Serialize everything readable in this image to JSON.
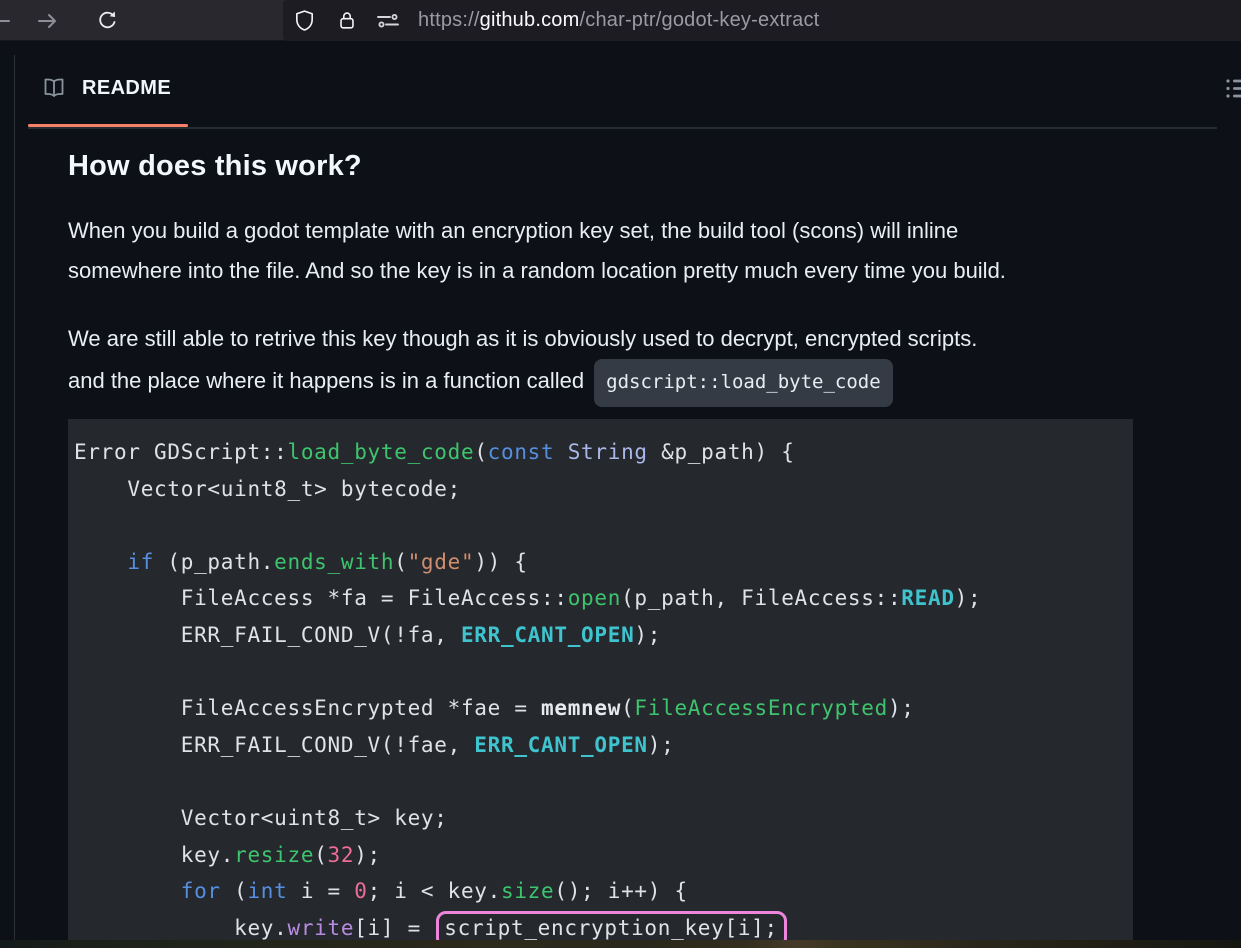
{
  "browser": {
    "url_scheme": "https://",
    "url_domain": "github.com",
    "url_path": "/char-ptr/godot-key-extract"
  },
  "readme": {
    "tab_label": "README",
    "heading": "How does this work?",
    "paragraph1_line1": "When you build a godot template with an encryption key set, the build tool (scons) will inline",
    "paragraph1_line2": "somewhere into the file. And so the key is in a random location pretty much every time you build.",
    "paragraph2_line1": "We are still able to retrive this key though as it is obviously used to decrypt, encrypted scripts.",
    "paragraph2_line2_text": "and the place where it happens is in a function called",
    "paragraph2_inline_code": "gdscript::load_byte_code"
  },
  "code_block": {
    "language": "cpp",
    "annotation": "pink rounded box highlighting script_encryption_key[i];",
    "lines": [
      {
        "tokens": [
          {
            "t": "Error GDScript::",
            "c": "pl"
          },
          {
            "t": "load_byte_code",
            "c": "fn"
          },
          {
            "t": "(",
            "c": "pl"
          },
          {
            "t": "const",
            "c": "kw"
          },
          {
            "t": " ",
            "c": "pl"
          },
          {
            "t": "String",
            "c": "ty"
          },
          {
            "t": " &p_path) {",
            "c": "pl"
          }
        ]
      },
      {
        "tokens": [
          {
            "t": "    Vector<uint8_t> bytecode;",
            "c": "pl"
          }
        ]
      },
      {
        "tokens": []
      },
      {
        "tokens": [
          {
            "t": "    ",
            "c": "pl"
          },
          {
            "t": "if",
            "c": "kw"
          },
          {
            "t": " (p_path.",
            "c": "pl"
          },
          {
            "t": "ends_with",
            "c": "fn"
          },
          {
            "t": "(",
            "c": "pl"
          },
          {
            "t": "\"gde\"",
            "c": "st"
          },
          {
            "t": ")) {",
            "c": "pl"
          }
        ]
      },
      {
        "tokens": [
          {
            "t": "        FileAccess *fa = FileAccess::",
            "c": "pl"
          },
          {
            "t": "open",
            "c": "fn"
          },
          {
            "t": "(p_path, FileAccess::",
            "c": "pl"
          },
          {
            "t": "READ",
            "c": "ct"
          },
          {
            "t": ");",
            "c": "pl"
          }
        ]
      },
      {
        "tokens": [
          {
            "t": "        ERR_FAIL_COND_V(!fa, ",
            "c": "pl"
          },
          {
            "t": "ERR_CANT_OPEN",
            "c": "ct"
          },
          {
            "t": ");",
            "c": "pl"
          }
        ]
      },
      {
        "tokens": []
      },
      {
        "tokens": [
          {
            "t": "        FileAccessEncrypted *fae = ",
            "c": "pl"
          },
          {
            "t": "memnew",
            "c": "bd"
          },
          {
            "t": "(",
            "c": "pl"
          },
          {
            "t": "FileAccessEncrypted",
            "c": "fn"
          },
          {
            "t": ");",
            "c": "pl"
          }
        ]
      },
      {
        "tokens": [
          {
            "t": "        ERR_FAIL_COND_V(!fae, ",
            "c": "pl"
          },
          {
            "t": "ERR_CANT_OPEN",
            "c": "ct"
          },
          {
            "t": ");",
            "c": "pl"
          }
        ]
      },
      {
        "tokens": []
      },
      {
        "tokens": [
          {
            "t": "        Vector<uint8_t> key;",
            "c": "pl"
          }
        ]
      },
      {
        "tokens": [
          {
            "t": "        key.",
            "c": "pl"
          },
          {
            "t": "resize",
            "c": "fn"
          },
          {
            "t": "(",
            "c": "pl"
          },
          {
            "t": "32",
            "c": "nm"
          },
          {
            "t": ");",
            "c": "pl"
          }
        ]
      },
      {
        "tokens": [
          {
            "t": "        ",
            "c": "pl"
          },
          {
            "t": "for",
            "c": "kw"
          },
          {
            "t": " (",
            "c": "pl"
          },
          {
            "t": "int",
            "c": "kw"
          },
          {
            "t": " i = ",
            "c": "pl"
          },
          {
            "t": "0",
            "c": "nm"
          },
          {
            "t": "; i < key.",
            "c": "pl"
          },
          {
            "t": "size",
            "c": "fn"
          },
          {
            "t": "(); i++) {",
            "c": "pl"
          }
        ]
      },
      {
        "tokens": [
          {
            "t": "            key.",
            "c": "pl"
          },
          {
            "t": "write",
            "c": "pr"
          },
          {
            "t": "[i] = ",
            "c": "pl"
          },
          {
            "t": "script_encryption_key[i];",
            "c": "pl",
            "box": true
          }
        ]
      }
    ]
  },
  "icons": {
    "back": "back-arrow-icon",
    "forward": "forward-arrow-icon",
    "reload": "reload-icon",
    "shield": "tracking-protection-shield-icon",
    "lock": "https-lock-icon",
    "permissions": "site-permissions-icon",
    "book": "book-icon",
    "outline": "outline-list-icon"
  },
  "colors": {
    "tab_accent_orange": "#f78166",
    "annotation_pink": "#ee85dd",
    "page_background": "#0d1117",
    "code_background": "#25282c",
    "syntax_keyword_blue": "#568fe0",
    "syntax_function_green": "#3ec46e",
    "syntax_string_orange": "#cf8e6d",
    "syntax_constant_teal": "#3fc3ce",
    "syntax_number_pink": "#ed6d95",
    "syntax_property_purple": "#b88be2"
  }
}
